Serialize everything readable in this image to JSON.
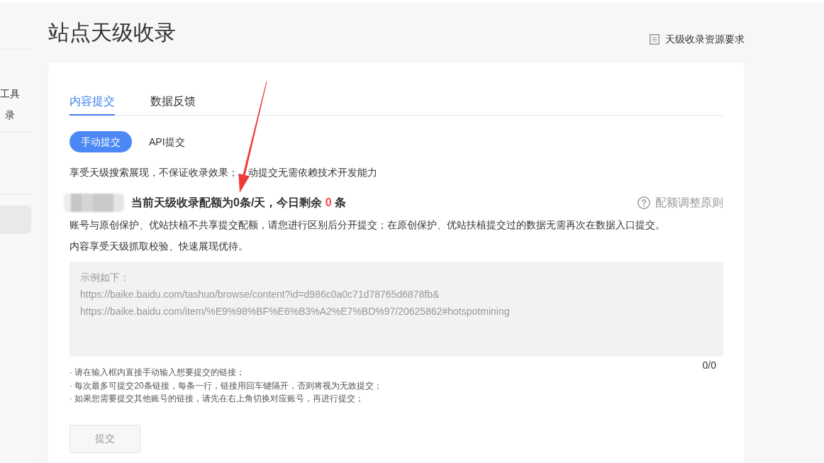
{
  "sidebar": {
    "sections": [
      {
        "items": [
          {
            "label": "工具",
            "selected": false
          },
          {
            "label": "录",
            "selected": false
          }
        ]
      },
      {
        "items": [
          {
            "selected": true
          }
        ]
      }
    ]
  },
  "header": {
    "title": "站点天级收录",
    "help_link": "天级收录资源要求"
  },
  "tabs": [
    {
      "label": "内容提交",
      "selected": true
    },
    {
      "label": "数据反馈",
      "selected": false
    }
  ],
  "modes": [
    {
      "label": "手动提交",
      "selected": true
    },
    {
      "label": "API提交",
      "selected": false
    }
  ],
  "description": [
    "享受天级搜索展现，不保证收录效果；",
    "动提交无需依赖技术开发能力"
  ],
  "quota": {
    "account_blurred": true,
    "text_before": "当前天级收录配额为0条/天，今日剩余",
    "remaining": "0",
    "text_after": "条",
    "rule_link": "配额调整原则"
  },
  "notices": [
    "账号与原创保护、优站扶植不共享提交配额，请您进行区别后分开提交；在原创保护、优站扶植提交过的数据无需再次在数据入口提交。",
    "内容享受天级抓取校验、快速展现优待。"
  ],
  "link_input": {
    "placeholder": "示例如下：\nhttps://baike.baidu.com/tashuo/browse/content?id=d986c0a0c71d78765d6878fb&\nhttps://baike.baidu.com/item/%E9%98%BF%E6%B3%A2%E7%BD%97/20625862#hotspotmining",
    "counter": "0/0"
  },
  "tips": [
    "· 请在输入框内直接手动输入想要提交的链接；",
    "· 每次最多可提交20条链接，每条一行，链接用回车键隔开，否则将视为无效提交；",
    "· 如果您需要提交其他账号的链接，请先在右上角切换对应账号，再进行提交；"
  ],
  "submit_button": {
    "label": "提交",
    "disabled": true
  },
  "annotations": [
    {
      "kind": "arrow"
    }
  ]
}
